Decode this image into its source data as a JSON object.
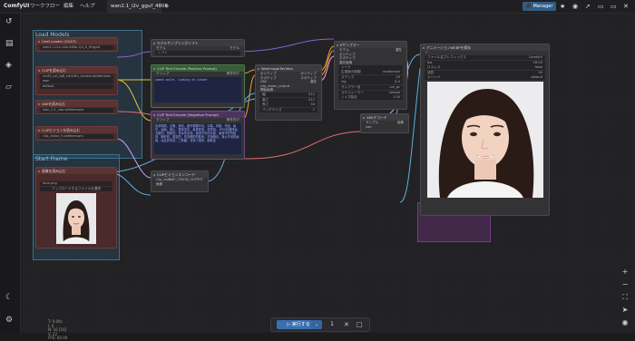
{
  "app": {
    "logo": "ComfyUI"
  },
  "menu": [
    "ワークフロー",
    "編集",
    "ヘルプ"
  ],
  "tab": {
    "name": "wan2.1_i2v_gguf_480P",
    "dot": "●",
    "add": "+"
  },
  "topbar_right": {
    "manager": "Manager"
  },
  "groups": {
    "load_models": "Load Models",
    "start_frame": "Start Frame"
  },
  "nodes": {
    "unet": {
      "title": "Unet Loader (GGUF)",
      "field": "wan2.1-i2v-14b-480p-Q4_K_M.gguf"
    },
    "clip": {
      "title": "CLIPを読み込む",
      "field1": "umt5_xxl_fp8_e4m3fn_scaled.safetensors",
      "field2": "wan",
      "field3": "default"
    },
    "vae": {
      "title": "VAEを読み込む",
      "field": "wan_2.1_vae.safetensors"
    },
    "clipvision": {
      "title": "CLIPビジョンを読み込む",
      "field": "clip_vision_h.safetensors"
    },
    "loadimage": {
      "title": "画像を読み込む",
      "field": "face.png",
      "upload": "アップロードするファイルを選択"
    },
    "samplingshift": {
      "title": "モデルサンプリングシフト",
      "in": "モデル",
      "out": "モデル",
      "field": "シフト"
    },
    "pos": {
      "title": "CLIP Text Encode (Positive Prompt)",
      "in": "クリップ",
      "out": "条件付け",
      "text": "woman smile, looking at viewer"
    },
    "neg": {
      "title": "CLIP Text Encode (Negative Prompt)",
      "in": "クリップ",
      "out": "条件付け",
      "text": "色调艳丽，过曝，静态，细节模糊不清，字幕，风格，作品，画作，画面，静止，整体发灰，最差质量，低质量，JPEG压缩残留，丑陋的，残缺的，多余的手指，画得不好的手部，画得不好的脸部，畸形的，毁容的，形态畸形的肢体，手指融合，静止不动的画面，杂乱的背景，三条腿，背景人很多，倒着走"
    },
    "wanimg": {
      "title": "WanImageToVideo",
      "labels": [
        "ポジティブ",
        "ネガティブ",
        "VAE",
        "clip_vision_output",
        "開始画像",
        "幅",
        "高さ",
        "長さ",
        "バッチサイズ"
      ],
      "values": [
        "",
        "",
        "",
        "",
        "",
        "512",
        "512",
        "33",
        "1"
      ],
      "outs": [
        "ポジティブ",
        "ネガティブ",
        "潜在"
      ]
    },
    "clipvisionenc": {
      "title": "CLIPビジョンエンコード",
      "labels": [
        "clip_vision",
        "画像"
      ],
      "field": "crop_center_crop",
      "out": "CLIP_VISION_OUTPUT"
    },
    "ksampler": {
      "title": "Kサンプラー",
      "labels": [
        "モデル",
        "ポジティブ",
        "ネガティブ",
        "潜在画像"
      ],
      "fields": [
        "シード",
        "生成後の制御",
        "ステップ",
        "cfg",
        "サンプラー名",
        "スケジューラー",
        "ノイズ除去"
      ],
      "values": [
        "",
        "randomize",
        "20",
        "6.0",
        "uni_pc",
        "simple",
        "1.00"
      ],
      "out": "潜在"
    },
    "vaedecode": {
      "title": "VAEデコード",
      "labels": [
        "サンプル",
        "vae"
      ],
      "out": "画像"
    },
    "saveanim": {
      "title": "アニメーションWEBPを保存",
      "labels": [
        "ファイル名プレフィックス",
        "fps",
        "ロスレス",
        "品質",
        "メソッド"
      ],
      "values": [
        "ComfyUI",
        "16.00",
        "false",
        "90",
        "default"
      ]
    }
  },
  "status": [
    "T: 0.00s",
    "I: 0",
    "N: 16 [16]",
    "V: 22",
    "FPS: 60.00"
  ],
  "run": {
    "label": "実行する",
    "count": "1"
  }
}
